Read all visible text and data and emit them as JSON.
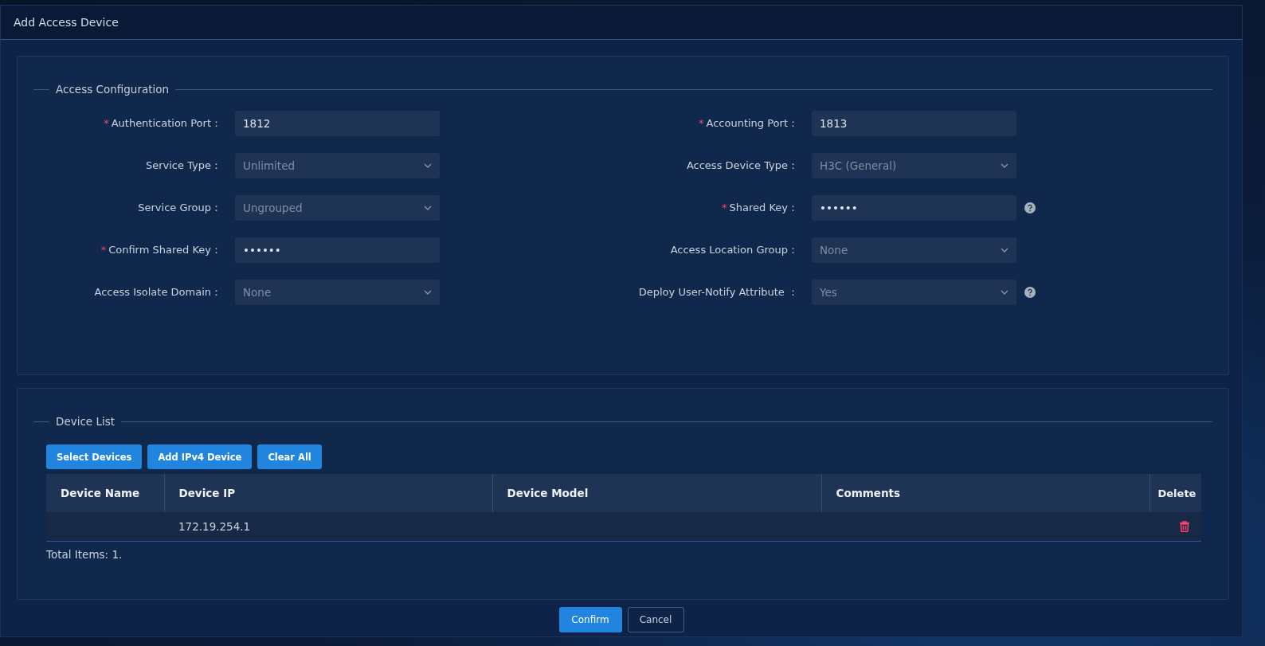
{
  "window": {
    "title": "Add Access Device"
  },
  "access_configuration": {
    "legend": "Access Configuration",
    "fields": [
      {
        "required_mark": "*",
        "label": "Authentication Port：",
        "kind": "text",
        "value": "1812",
        "help": false
      },
      {
        "required_mark": "*",
        "label": "Accounting Port：",
        "kind": "text",
        "value": "1813",
        "help": false
      },
      {
        "label": "Service Type：",
        "kind": "select",
        "value": "Unlimited",
        "help": false
      },
      {
        "label": "Access Device Type：",
        "kind": "select",
        "value": "H3C (General)",
        "help": false
      },
      {
        "label": "Service Group：",
        "kind": "select",
        "value": "Ungrouped",
        "help": false
      },
      {
        "required_mark": "*",
        "label": "Shared Key：",
        "kind": "password",
        "value": "••••••",
        "help": true
      },
      {
        "required_mark": "*",
        "label": "Confirm Shared Key：",
        "kind": "password",
        "value": "••••••",
        "help": false
      },
      {
        "label": "Access Location Group：",
        "kind": "select",
        "value": "None",
        "help": false
      },
      {
        "label": "Access Isolate Domain：",
        "kind": "select",
        "value": "None",
        "help": false
      },
      {
        "label": "Deploy User-Notify Attribute ：",
        "kind": "select",
        "value": "Yes",
        "help": true
      }
    ]
  },
  "device_list": {
    "legend": "Device List",
    "buttons": [
      "Select Devices",
      "Add IPv4 Device",
      "Clear All"
    ],
    "table": {
      "columns": [
        "Device Name",
        "Device IP",
        "Device Model",
        "Comments",
        "Delete"
      ],
      "rows": [
        {
          "cells": [
            "",
            "172.19.254.1",
            "",
            ""
          ],
          "delete": true
        }
      ]
    },
    "total": "Total Items: 1."
  },
  "buttons": [
    {
      "label": "Confirm",
      "kind": "primary"
    },
    {
      "label": "Cancel",
      "kind": "secondary"
    }
  ]
}
